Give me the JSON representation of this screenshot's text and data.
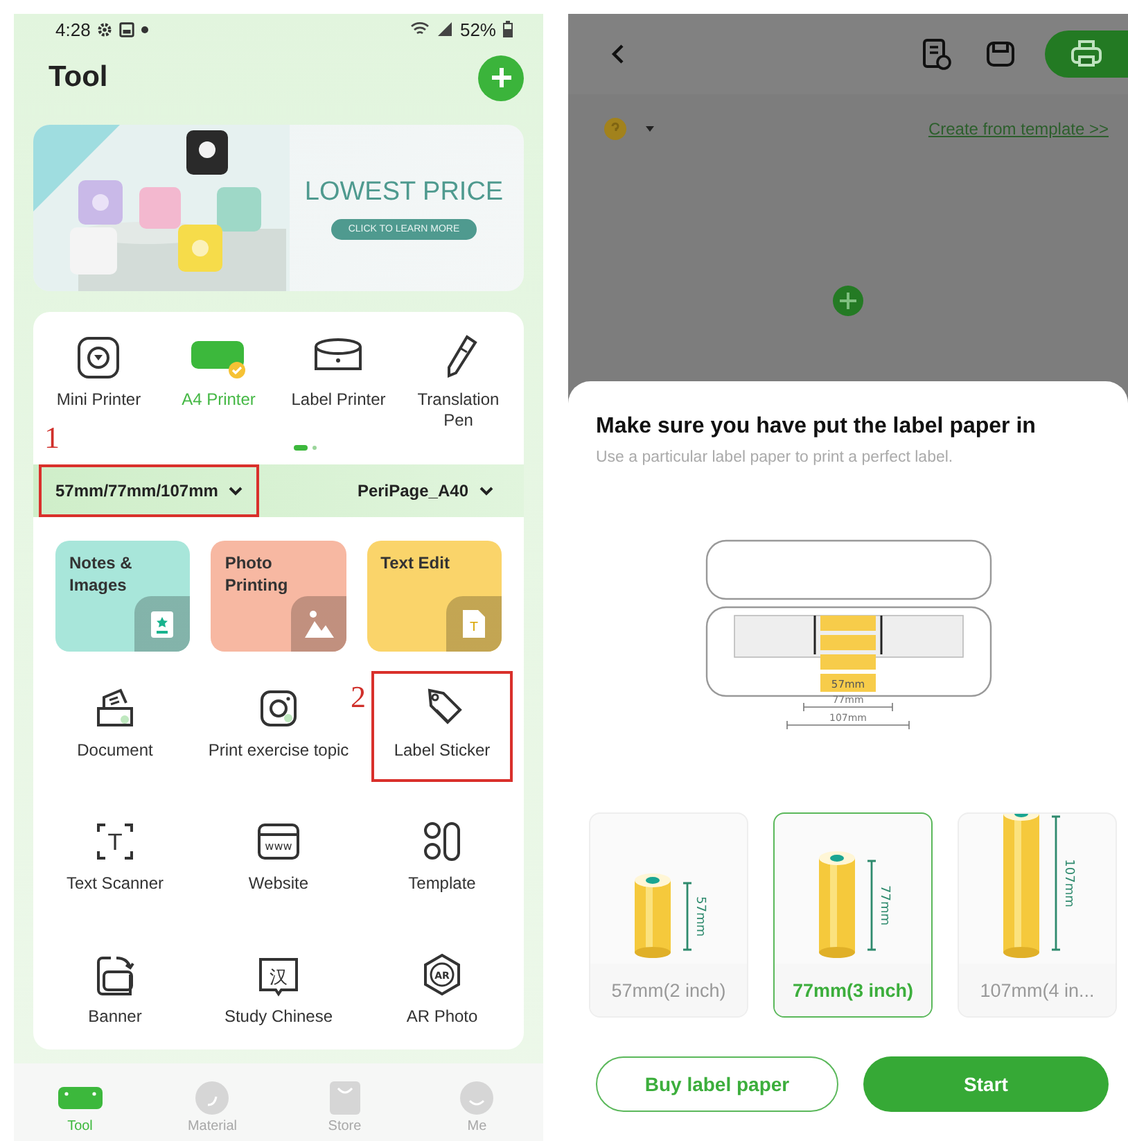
{
  "left_screen": {
    "status_bar": {
      "time": "4:28",
      "battery": "52%"
    },
    "header": {
      "title": "Tool"
    },
    "banner": {
      "headline": "LOWEST PRICE",
      "button": "CLICK TO LEARN MORE"
    },
    "devices": [
      {
        "label": "Mini Printer",
        "selected": false
      },
      {
        "label": "A4 Printer",
        "selected": true
      },
      {
        "label": "Label Printer",
        "selected": false
      },
      {
        "label": "Translation Pen",
        "selected": false
      }
    ],
    "paper_size": {
      "label": "57mm/77mm/107mm",
      "callout": "1"
    },
    "printer": {
      "label": "PeriPage_A40"
    },
    "feature_tiles": [
      {
        "label": "Notes & Images",
        "color": "#a8e6da"
      },
      {
        "label": "Photo Printing",
        "color": "#f7b8a2"
      },
      {
        "label": "Text Edit",
        "color": "#fad46a",
        "icon_text": "T"
      }
    ],
    "tools": [
      {
        "label": "Document"
      },
      {
        "label": "Print exercise topic"
      },
      {
        "label": "Label Sticker",
        "callout": "2"
      },
      {
        "label": "Text Scanner",
        "icon_text": "T"
      },
      {
        "label": "Website",
        "icon_text": "www"
      },
      {
        "label": "Template"
      },
      {
        "label": "Banner"
      },
      {
        "label": "Study Chinese",
        "icon_text": "汉"
      },
      {
        "label": "AR Photo",
        "icon_text": "AR"
      }
    ],
    "bottom_nav": [
      {
        "label": "Tool",
        "selected": true
      },
      {
        "label": "Material",
        "selected": false
      },
      {
        "label": "Store",
        "selected": false
      },
      {
        "label": "Me",
        "selected": false
      }
    ]
  },
  "right_screen": {
    "template_link": "Create from template >>",
    "sheet": {
      "title": "Make sure you have put the label paper in",
      "subtitle": "Use a particular label paper to print a perfect label.",
      "diagram_labels": [
        "57mm",
        "77mm",
        "107mm"
      ],
      "options": [
        {
          "label": "57mm(2 inch)",
          "roll_label": "57mm",
          "selected": false
        },
        {
          "label": "77mm(3 inch)",
          "roll_label": "77mm",
          "selected": true
        },
        {
          "label": "107mm(4 in...",
          "roll_label": "107mm",
          "selected": false
        }
      ],
      "secondary_button": "Buy label paper",
      "primary_button": "Start"
    }
  }
}
